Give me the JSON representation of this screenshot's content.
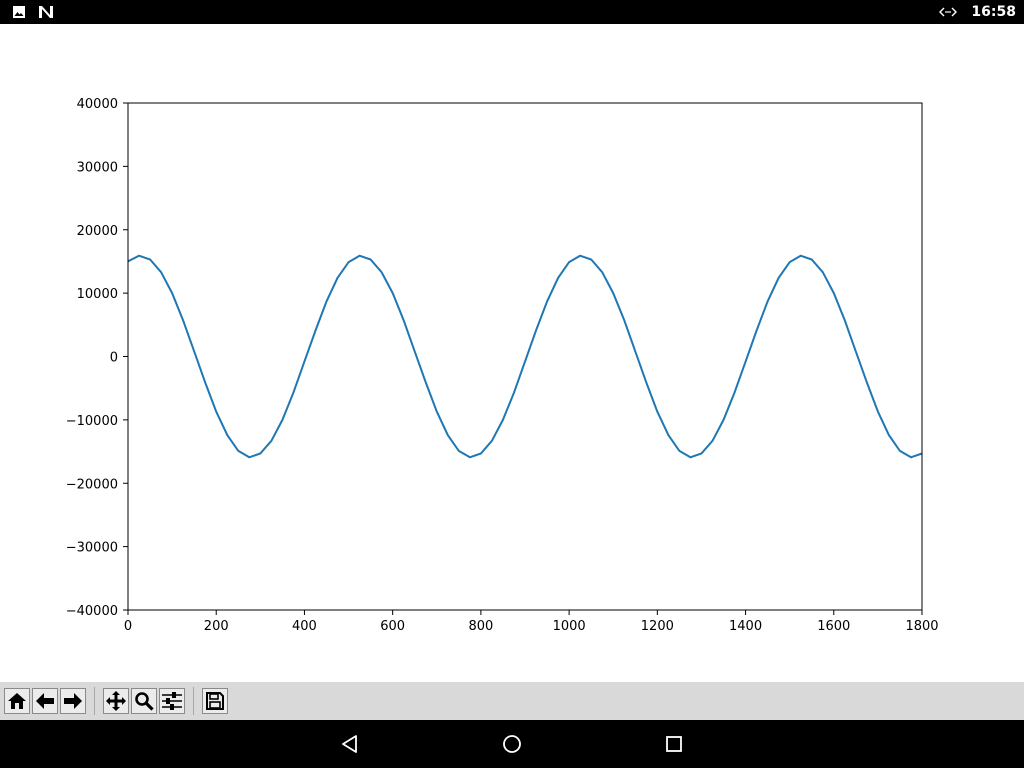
{
  "status_bar": {
    "time": "16:58",
    "left_icons": [
      "image-notification-icon",
      "n-app-notification-icon"
    ],
    "right_icons": [
      "data-sync-icon"
    ]
  },
  "chart_data": {
    "type": "line",
    "title": "",
    "xlabel": "",
    "ylabel": "",
    "xlim": [
      0,
      1800
    ],
    "ylim": [
      -40000,
      40000
    ],
    "x_ticks": [
      0,
      200,
      400,
      600,
      800,
      1000,
      1200,
      1400,
      1600,
      1800
    ],
    "y_ticks": [
      40000,
      30000,
      20000,
      10000,
      0,
      -10000,
      -20000,
      -30000,
      -40000
    ],
    "x_tick_labels": [
      "0",
      "200",
      "400",
      "600",
      "800",
      "1000",
      "1200",
      "1400",
      "1600",
      "1800"
    ],
    "y_tick_labels": [
      "40000",
      "30000",
      "20000",
      "10000",
      "0",
      "−10000",
      "−20000",
      "−30000",
      "−40000"
    ],
    "grid": false,
    "color": "#1f77b4",
    "series": [
      {
        "x": [
          0,
          25,
          50,
          75,
          100,
          125,
          150,
          175,
          200,
          225,
          250,
          275,
          300,
          325,
          350,
          375,
          400,
          425,
          450,
          475,
          500,
          525,
          550,
          575,
          600,
          625,
          650,
          675,
          700,
          725,
          750,
          775,
          800,
          825,
          850,
          875,
          900,
          925,
          950,
          975,
          1000,
          1025,
          1050,
          1075,
          1100,
          1125,
          1150,
          1175,
          1200,
          1225,
          1250,
          1275,
          1300,
          1325,
          1350,
          1375,
          1400,
          1425,
          1450,
          1475,
          1500,
          1525,
          1550,
          1575,
          1600,
          1625,
          1650,
          1675,
          1700,
          1725,
          1750,
          1775,
          1800
        ],
        "y": [
          15000,
          15900,
          15300,
          13300,
          10000,
          5700,
          800,
          -4100,
          -8700,
          -12400,
          -14900,
          -15900,
          -15300,
          -13300,
          -10000,
          -5700,
          -800,
          4100,
          8700,
          12400,
          14900,
          15900,
          15300,
          13300,
          10000,
          5700,
          800,
          -4100,
          -8700,
          -12400,
          -14900,
          -15900,
          -15300,
          -13300,
          -10000,
          -5700,
          -800,
          4100,
          8700,
          12400,
          14900,
          15900,
          15300,
          13300,
          10000,
          5700,
          800,
          -4100,
          -8700,
          -12400,
          -14900,
          -15900,
          -15300,
          -13300,
          -10000,
          -5700,
          -800,
          4100,
          8700,
          12400,
          14900,
          15900,
          15300,
          13300,
          10000,
          5700,
          800,
          -4100,
          -8700,
          -12400,
          -14900,
          -15900,
          -15300
        ]
      }
    ]
  },
  "toolbar": {
    "buttons": [
      {
        "name": "home-button",
        "icon": "home-icon"
      },
      {
        "name": "back-button",
        "icon": "arrow-left-icon"
      },
      {
        "name": "forward-button",
        "icon": "arrow-right-icon"
      },
      {
        "name": "pan-button",
        "icon": "move-icon"
      },
      {
        "name": "zoom-button",
        "icon": "magnifier-icon"
      },
      {
        "name": "configure-subplots-button",
        "icon": "sliders-icon"
      },
      {
        "name": "save-button",
        "icon": "floppy-disk-icon"
      }
    ]
  },
  "nav_bar": {
    "buttons": [
      "back-triangle-icon",
      "home-circle-icon",
      "recents-square-icon"
    ]
  }
}
